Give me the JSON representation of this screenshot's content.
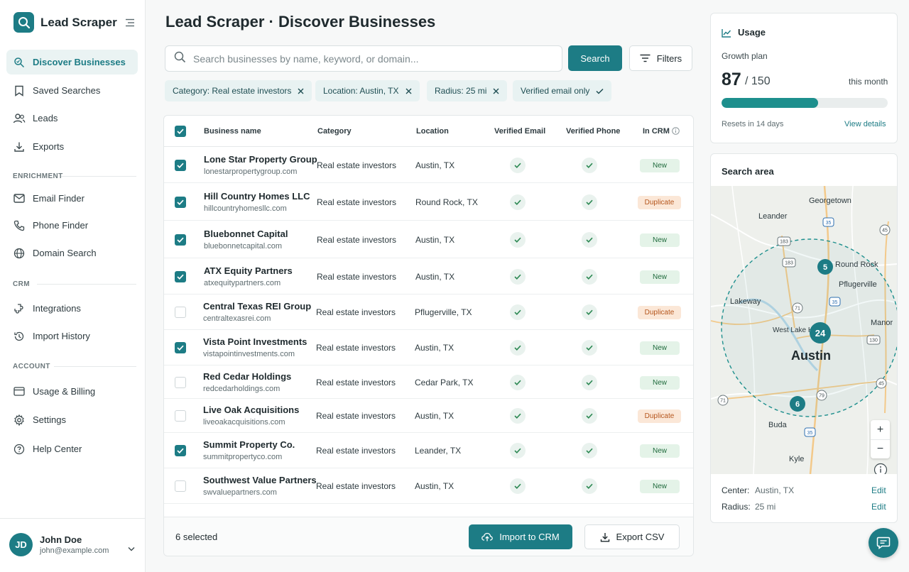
{
  "app": {
    "name": "Lead Scraper"
  },
  "sidebar": {
    "nav": [
      {
        "label": "Discover Businesses",
        "icon": "discover-icon",
        "active": true
      },
      {
        "label": "Saved Searches",
        "icon": "bookmark-icon"
      },
      {
        "label": "Leads",
        "icon": "users-icon"
      },
      {
        "label": "Exports",
        "icon": "download-icon"
      }
    ],
    "enrichment_label": "ENRICHMENT",
    "enrichment": [
      {
        "label": "Email Finder",
        "icon": "mail-icon"
      },
      {
        "label": "Phone Finder",
        "icon": "phone-icon"
      },
      {
        "label": "Domain Search",
        "icon": "globe-icon"
      }
    ],
    "crm_label": "CRM",
    "crm": [
      {
        "label": "Integrations",
        "icon": "integrations-icon"
      },
      {
        "label": "Import History",
        "icon": "history-icon"
      }
    ],
    "account_label": "ACCOUNT",
    "account": [
      {
        "label": "Usage & Billing",
        "icon": "card-icon"
      },
      {
        "label": "Settings",
        "icon": "gear-icon"
      },
      {
        "label": "Help Center",
        "icon": "help-icon"
      }
    ],
    "user": {
      "initials": "JD",
      "name": "John Doe",
      "email": "john@example.com"
    }
  },
  "main": {
    "title": "Lead Scraper · Discover Businesses",
    "search": {
      "placeholder": "Search businesses by name, keyword, or domain...",
      "value": "",
      "button": "Search"
    },
    "filters_button": "Filters",
    "chips": [
      {
        "label": "Category: Real estate investors",
        "action": "remove"
      },
      {
        "label": "Location: Austin, TX",
        "action": "remove"
      },
      {
        "label": "Radius: 25 mi",
        "action": "remove"
      },
      {
        "label": "Verified email only",
        "action": "check"
      }
    ]
  },
  "table": {
    "headers": {
      "name": "Business name",
      "category": "Category",
      "location": "Location",
      "email": "Verified Email",
      "phone": "Verified Phone",
      "crm": "In CRM"
    },
    "rows": [
      {
        "name": "Lone Star Property Group",
        "domain": "lonestarpropertygroup.com",
        "category": "Real estate investors",
        "location": "Austin, TX",
        "checked": true,
        "status": "New"
      },
      {
        "name": "Hill Country Homes LLC",
        "domain": "hillcountryhomesllc.com",
        "category": "Real estate investors",
        "location": "Round Rock, TX",
        "checked": true,
        "status": "Duplicate"
      },
      {
        "name": "Bluebonnet Capital",
        "domain": "bluebonnetcapital.com",
        "category": "Real estate investors",
        "location": "Austin, TX",
        "checked": true,
        "status": "New"
      },
      {
        "name": "ATX Equity Partners",
        "domain": "atxequitypartners.com",
        "category": "Real estate investors",
        "location": "Austin, TX",
        "checked": true,
        "status": "New"
      },
      {
        "name": "Central Texas REI Group",
        "domain": "centraltexasrei.com",
        "category": "Real estate investors",
        "location": "Pflugerville, TX",
        "checked": false,
        "status": "Duplicate"
      },
      {
        "name": "Vista Point Investments",
        "domain": "vistapointinvestments.com",
        "category": "Real estate investors",
        "location": "Austin, TX",
        "checked": true,
        "status": "New"
      },
      {
        "name": "Red Cedar Holdings",
        "domain": "redcedarholdings.com",
        "category": "Real estate investors",
        "location": "Cedar Park, TX",
        "checked": false,
        "status": "New"
      },
      {
        "name": "Live Oak Acquisitions",
        "domain": "liveoakacquisitions.com",
        "category": "Real estate investors",
        "location": "Austin, TX",
        "checked": false,
        "status": "Duplicate"
      },
      {
        "name": "Summit Property Co.",
        "domain": "summitpropertyco.com",
        "category": "Real estate investors",
        "location": "Leander, TX",
        "checked": true,
        "status": "New"
      },
      {
        "name": "Southwest Value Partners",
        "domain": "swvaluepartners.com",
        "category": "Real estate investors",
        "location": "Austin, TX",
        "checked": false,
        "status": "New"
      }
    ],
    "footer": {
      "selected": "6 selected",
      "import_button": "Import to CRM",
      "export_button": "Export CSV"
    }
  },
  "usage": {
    "title": "Usage",
    "plan": "Growth plan",
    "used": "87",
    "limit": "/ 150",
    "used_value": 87,
    "limit_value": 150,
    "period": "this month",
    "resets": "Resets in 14 days",
    "view_details": "View details"
  },
  "search_area": {
    "title": "Search area",
    "map_labels": {
      "georgetown": "Georgetown",
      "leander": "Leander",
      "round_rock": "Round Rock",
      "pflugerville": "Pflugerville",
      "lakeway": "Lakeway",
      "west_lake_hills": "West Lake Hills",
      "austin": "Austin",
      "manor": "Manor",
      "buda": "Buda",
      "kyle": "Kyle"
    },
    "route_shields": [
      "35",
      "45",
      "183",
      "183",
      "35",
      "71",
      "130",
      "79",
      "71",
      "45",
      "35"
    ],
    "clusters": [
      "5",
      "24",
      "6"
    ],
    "center_label": "Center:",
    "center_value": "Austin, TX",
    "radius_label": "Radius:",
    "radius_value": "25 mi",
    "edit_label": "Edit",
    "zoom_in": "+",
    "zoom_out": "−"
  },
  "colors": {
    "accent": "#1d7c85",
    "new_badge": "#e4f3e8",
    "duplicate_badge": "#fbe7d7"
  }
}
